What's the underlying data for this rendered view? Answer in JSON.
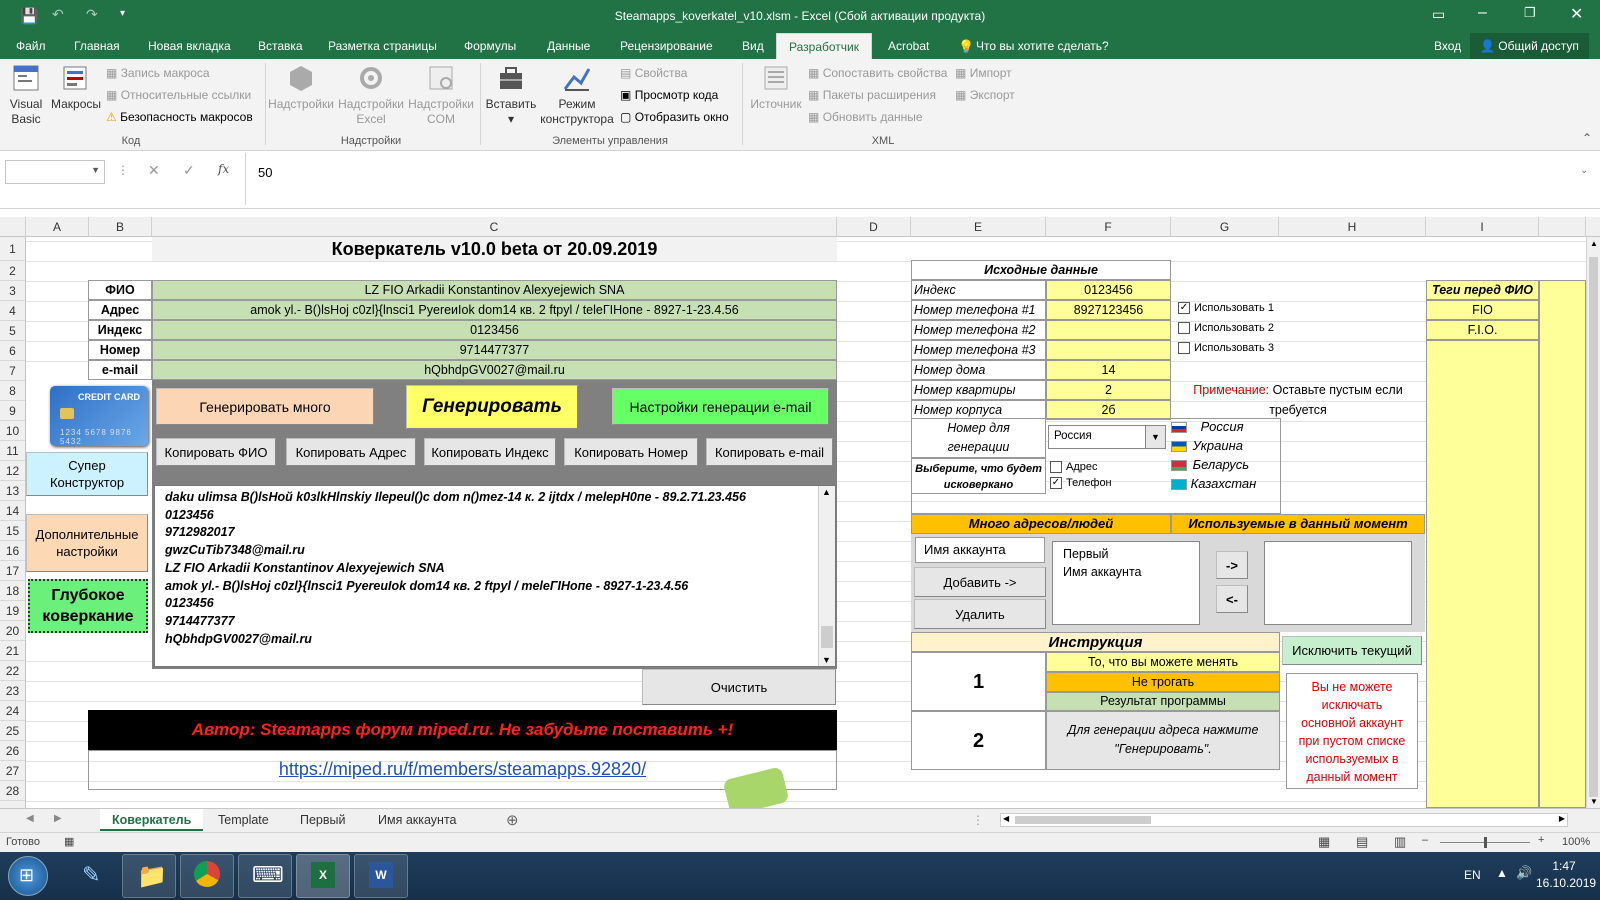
{
  "window": {
    "title": "Steamapps_koverkatel_v10.xlsm - Excel (Сбой активации продукта)"
  },
  "ribbon_tabs": [
    "Файл",
    "Главная",
    "Новая вкладка",
    "Вставка",
    "Разметка страницы",
    "Формулы",
    "Данные",
    "Рецензирование",
    "Вид",
    "Разработчик",
    "Acrobat"
  ],
  "ribbon_tell": "Что вы хотите сделать?",
  "ribbon_login": "Вход",
  "ribbon_share": "Общий доступ",
  "ribbon": {
    "code": {
      "vb_line1": "Visual",
      "vb_line2": "Basic",
      "macros": "Макросы",
      "record": "Запись макроса",
      "relative": "Относительные ссылки",
      "security": "Безопасность макросов",
      "group": "Код"
    },
    "addins": {
      "addins": "Надстройки",
      "excel_l1": "Надстройки",
      "excel_l2": "Excel",
      "com_l1": "Надстройки",
      "com_l2": "COM",
      "group": "Надстройки"
    },
    "controls": {
      "insert": "Вставить",
      "design_l1": "Режим",
      "design_l2": "конструктора",
      "props": "Свойства",
      "viewcode": "Просмотр кода",
      "dialog": "Отобразить окно",
      "group": "Элементы управления"
    },
    "xml": {
      "source": "Источник",
      "mapprops": "Сопоставить свойства",
      "packs": "Пакеты расширения",
      "refresh": "Обновить данные",
      "import": "Импорт",
      "export": "Экспорт",
      "group": "XML"
    }
  },
  "formula": {
    "fx": "fx",
    "value": "50"
  },
  "columns": [
    "A",
    "B",
    "C",
    "D",
    "E",
    "F",
    "G",
    "H",
    "I"
  ],
  "rows": [
    "1",
    "2",
    "3",
    "4",
    "5",
    "6",
    "7",
    "8",
    "9",
    "10",
    "11",
    "12",
    "13",
    "14",
    "15",
    "16",
    "17",
    "18",
    "19",
    "20",
    "21",
    "22",
    "23",
    "24",
    "25",
    "26",
    "27",
    "28"
  ],
  "sheet": {
    "title": "Коверкатель v10.0 beta от 20.09.2019",
    "labels": {
      "fio": "ФИО",
      "address": "Адрес",
      "index": "Индекс",
      "number": "Номер",
      "email": "e-mail"
    },
    "values": {
      "fio": "LZ FIO Arkadii Konstantinov Alexyejewich SNA",
      "address": "amok yl.- B()lsHoj  c0zl}{lnsci1  PyereиIok dom14 кв. 2 ftpyl  / teleГIНопе - 8927-1-23.4.56",
      "index": "0123456",
      "number": "9714477377",
      "email": "hQbhdpGV0027@mail.ru"
    },
    "card_label": "CREDIT CARD",
    "card_number": "1234 5678 9876 5432",
    "buttons": {
      "gen_many": "Генерировать много",
      "gen": "Генерировать",
      "email_settings": "Настройки генерации e-mail",
      "copy_fio": "Копировать ФИО",
      "copy_addr": "Копировать Адрес",
      "copy_index": "Копировать Индекс",
      "copy_number": "Копировать Номер",
      "copy_email": "Копировать e-mail",
      "super_l1": "Супер",
      "super_l2": "Конструктор",
      "extra_l1": "Дополнительные",
      "extra_l2": "настройки",
      "deep_l1": "Глубокое",
      "deep_l2": "коверкание",
      "clear": "Очистить"
    },
    "output_lines": [
      "daku ulimsa B()lsНой  k0зlkНlпskiy  Ilepeul()c dom n()mez-14 к. 2 ijtdx  / melepН0пе - 89.2.71.23.456",
      "0123456",
      "9712982017",
      "gwzCuTib7348@mail.ru",
      "LZ FIO Arkadii Konstantinov Alexyejewich SNA",
      "amok yl.- B()lsHoj  c0zl}{lnsci1  PyereuIok dom14 кв. 2 ftpyl  / meleГIНопе - 8927-1-23.4.56",
      "0123456",
      "9714477377",
      "hQbhdpGV0027@mail.ru"
    ],
    "author": "Автор: Steamapps форум miped.ru. Не забудьте поставить +!",
    "link": "https://miped.ru/f/members/steamapps.92820/"
  },
  "source": {
    "header": "Исходные данные",
    "rows": [
      {
        "label": "Индекс",
        "value": "0123456"
      },
      {
        "label": "Номер телефона #1",
        "value": "8927123456"
      },
      {
        "label": "Номер телефона #2",
        "value": ""
      },
      {
        "label": "Номер телефона #3",
        "value": ""
      },
      {
        "label": "Номер дома",
        "value": "14"
      },
      {
        "label": "Номер квартиры",
        "value": "2"
      },
      {
        "label": "Номер корпуса",
        "value": "2б"
      }
    ],
    "use1": "Использовать 1",
    "use2": "Использовать 2",
    "use3": "Использовать 3",
    "note_red": "Примечание:",
    "note_rest": " Оставьте пустым если",
    "note_l2": "требуется",
    "gen_number_l1": "Номер для",
    "gen_number_l2": "генерации",
    "country_selected": "Россия",
    "countries": [
      "Россия",
      "Украина",
      "Беларусь",
      "Казахстан"
    ],
    "choose_l1": "Выберите, что будет",
    "choose_l2": "исковеркано",
    "opt_address": "Адрес",
    "opt_phone": "Телефон"
  },
  "many": {
    "header": "Много адресов/людей",
    "used_header": "Используемые в данный момент",
    "account_input": "Имя аккаунта",
    "add": "Добавить ->",
    "remove": "Удалить",
    "list": [
      "Первый",
      "Имя аккаунта"
    ],
    "to_right": "->",
    "to_left": "<-",
    "exclude": "Исключить текущий",
    "warning": [
      "Вы не можете",
      "исключать",
      "основной аккаунт",
      "при пустом списке",
      "используемых в",
      "данный момент"
    ]
  },
  "instruction": {
    "header": "Инструкция",
    "n1": "1",
    "n2": "2",
    "legend_yellow": "То, что вы можете менять",
    "legend_orange": "Не трогать",
    "legend_green": "Результат программы",
    "text_l1": "Для генерации адреса нажмите",
    "text_l2": "\"Генерировать\"."
  },
  "tags": {
    "header": "Теги перед ФИО",
    "items": [
      "FIO",
      "F.I.O."
    ]
  },
  "sheet_tabs": [
    "Коверкатель",
    "Template",
    "Первый",
    "Имя аккаунта"
  ],
  "status": {
    "ready": "Готово",
    "zoom": "100%"
  },
  "taskbar": {
    "lang": "EN",
    "time": "1:47",
    "date": "16.10.2019"
  },
  "colors": {
    "excel_green": "#217346",
    "cell_green": "#c6e0b4",
    "cell_yellow": "#ffff99",
    "cell_orange": "#ffc000"
  }
}
